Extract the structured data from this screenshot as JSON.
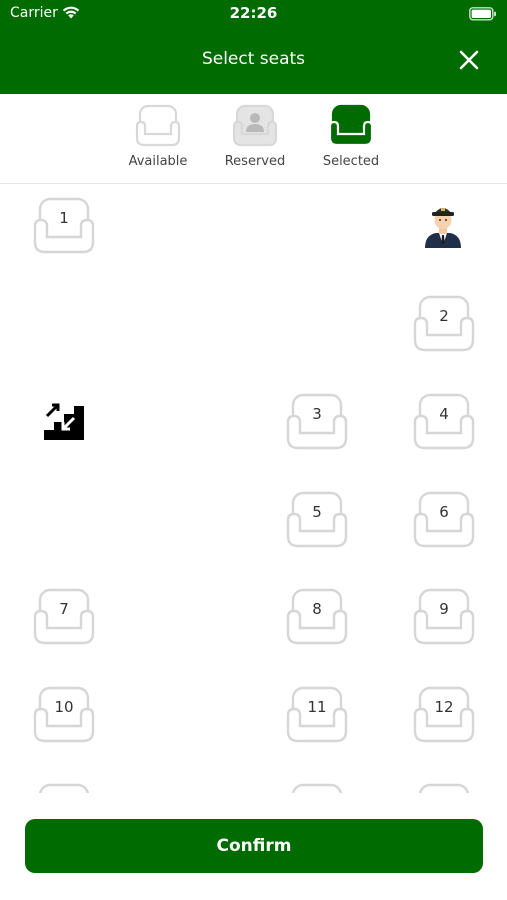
{
  "status_bar": {
    "carrier": "Carrier",
    "time": "22:26"
  },
  "header": {
    "title": "Select seats",
    "close_icon": "close-icon",
    "background": "#006b00"
  },
  "legend": [
    {
      "label": "Available",
      "state": "available"
    },
    {
      "label": "Reserved",
      "state": "reserved"
    },
    {
      "label": "Selected",
      "state": "selected"
    }
  ],
  "seats": [
    "1",
    "2",
    "3",
    "4",
    "5",
    "6",
    "7",
    "8",
    "9",
    "10",
    "11",
    "12"
  ],
  "icons": {
    "driver": "driver-icon",
    "stairs": "stairs-icon"
  },
  "confirm_label": "Confirm",
  "colors": {
    "brand_green": "#006b00",
    "seat_outline": "#d6d6d6",
    "reserved_fill": "#e4e4e4"
  }
}
